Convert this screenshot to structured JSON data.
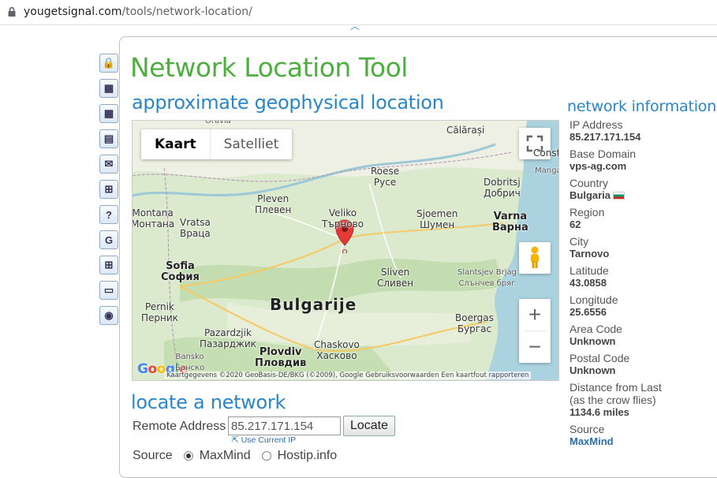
{
  "browser": {
    "url_host": "yougetsignal.com",
    "url_path": "/tools/network-location/"
  },
  "sidebar": {
    "items": [
      {
        "icon": "lock-icon",
        "glyph": "🔒"
      },
      {
        "icon": "map-icon",
        "glyph": "▦"
      },
      {
        "icon": "map-pin-icon",
        "glyph": "▦"
      },
      {
        "icon": "server-icon",
        "glyph": "▤"
      },
      {
        "icon": "mail-icon",
        "glyph": "✉"
      },
      {
        "icon": "network-icon",
        "glyph": "⊞"
      },
      {
        "icon": "help-icon",
        "glyph": "?"
      },
      {
        "icon": "google-icon",
        "glyph": "G"
      },
      {
        "icon": "windows-icon",
        "glyph": "⊞"
      },
      {
        "icon": "drive-icon",
        "glyph": "▭"
      },
      {
        "icon": "globe-icon",
        "glyph": "◉"
      }
    ]
  },
  "page": {
    "title": "Network Location Tool",
    "geo_heading": "approximate geophysical location",
    "locate_heading": "locate a network",
    "net_heading": "network information"
  },
  "map": {
    "tab_map": "Kaart",
    "tab_satellite": "Satelliet",
    "zoom_in": "+",
    "zoom_out": "−",
    "attribution": "Kaartgegevens ©2020 GeoBasis-DE/BKG (©2009), Google    Gebruiksvoorwaarden    Een kaartfout rapporteren",
    "logo": "Google",
    "country_label": "Bulgarije",
    "labels": [
      {
        "id": "oravia",
        "text": "Oravia",
        "cls": "small"
      },
      {
        "id": "calarasi",
        "text": "Călărași",
        "cls": ""
      },
      {
        "id": "constanta",
        "text": "Consta",
        "cls": ""
      },
      {
        "id": "roese",
        "text": "Roese\nРусе",
        "cls": ""
      },
      {
        "id": "dobritsj",
        "text": "Dobritsj\nДобрич",
        "cls": ""
      },
      {
        "id": "mangalia",
        "text": "Mangalia",
        "cls": "small"
      },
      {
        "id": "pleven",
        "text": "Pleven\nПлевен",
        "cls": ""
      },
      {
        "id": "vratsa",
        "text": "Vratsa\nВраца",
        "cls": ""
      },
      {
        "id": "montana",
        "text": "Montana\nМонтана",
        "cls": ""
      },
      {
        "id": "veliko",
        "text": "Veliko\nТърново",
        "cls": ""
      },
      {
        "id": "sjoemen",
        "text": "Sjoemen\nШумен",
        "cls": ""
      },
      {
        "id": "varna",
        "text": "Varna\nВарна",
        "cls": "big"
      },
      {
        "id": "sofia",
        "text": "Sofia\nСофия",
        "cls": "big"
      },
      {
        "id": "sliven",
        "text": "Sliven\nСливен",
        "cls": ""
      },
      {
        "id": "slantsjev",
        "text": "Slantsjev Brjag\nСлънчев бряг",
        "cls": "small"
      },
      {
        "id": "pernik",
        "text": "Pernik\nПерник",
        "cls": ""
      },
      {
        "id": "boergas",
        "text": "Boergas\nБургас",
        "cls": ""
      },
      {
        "id": "pazardzjik",
        "text": "Pazardzjik\nПазарджик",
        "cls": ""
      },
      {
        "id": "plovdiv",
        "text": "Plovdiv\nПловдив",
        "cls": "big"
      },
      {
        "id": "chaskovo",
        "text": "Chaskovo\nХасково",
        "cls": ""
      },
      {
        "id": "bansko",
        "text": "Bansko\nБанско",
        "cls": "small"
      }
    ]
  },
  "locate": {
    "remote_label": "Remote Address",
    "ip_value": "85.217.171.154",
    "locate_button": "Locate",
    "use_current": "Use Current IP",
    "source_label": "Source",
    "source_options": [
      "MaxMind",
      "Hostip.info"
    ],
    "source_selected": "MaxMind"
  },
  "netinfo": {
    "ip_label": "IP Address",
    "ip_value": "85.217.171.154",
    "domain_label": "Base Domain",
    "domain_value": "vps-ag.com",
    "country_label": "Country",
    "country_value": "Bulgaria",
    "region_label": "Region",
    "region_value": "62",
    "city_label": "City",
    "city_value": "Tarnovo",
    "lat_label": "Latitude",
    "lat_value": "43.0858",
    "lon_label": "Longitude",
    "lon_value": "25.6556",
    "area_label": "Area Code",
    "area_value": "Unknown",
    "postal_label": "Postal Code",
    "postal_value": "Unknown",
    "distance_label": "Distance from Last",
    "distance_label2": "(as the crow flies)",
    "distance_value": "1134.6 miles",
    "source_label": "Source",
    "source_value": "MaxMind"
  },
  "colors": {
    "title_green": "#4caf3f",
    "heading_blue": "#2a86c8",
    "link_blue": "#2a6fb0",
    "marker_red": "#e53935",
    "sea": "#aad3df"
  }
}
